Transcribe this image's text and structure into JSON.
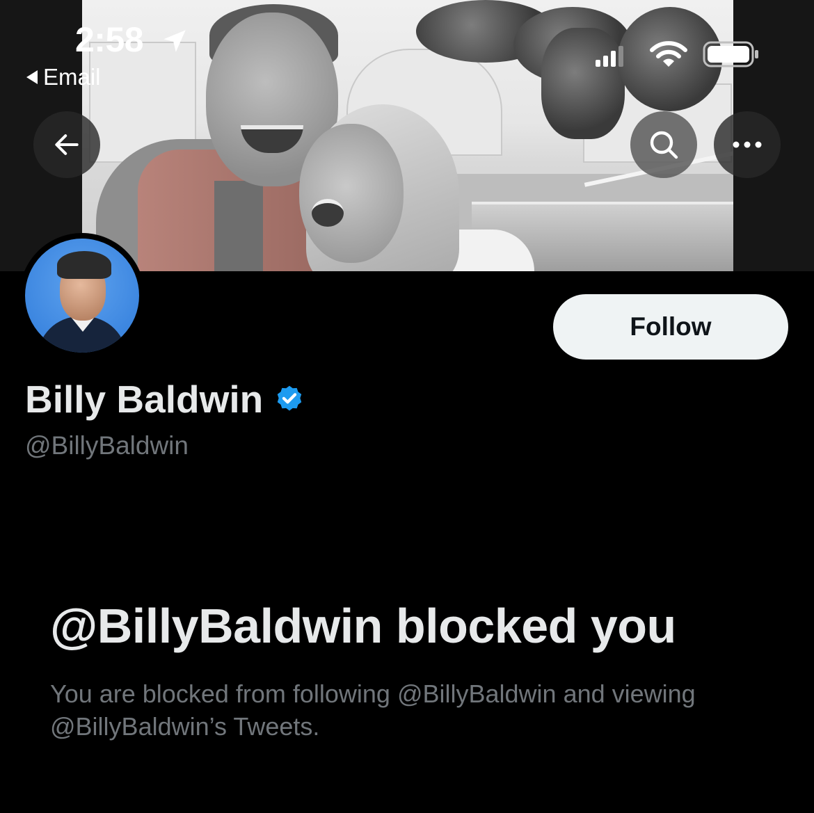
{
  "status_bar": {
    "time": "2:58",
    "back_app_label": "Email"
  },
  "profile": {
    "display_name": "Billy Baldwin",
    "verified": true,
    "handle": "@BillyBaldwin",
    "follow_label": "Follow"
  },
  "blocked_notice": {
    "title": "@BillyBaldwin blocked you",
    "description": "You are blocked from following @BillyBaldwin and viewing @BillyBaldwin’s Tweets."
  },
  "icons": {
    "back": "arrow-left-icon",
    "search": "search-icon",
    "more": "more-horizontal-icon",
    "verified": "verified-badge-icon",
    "location": "location-arrow-icon",
    "signal": "cellular-signal-icon",
    "wifi": "wifi-icon",
    "battery": "battery-icon"
  },
  "colors": {
    "background": "#000000",
    "primary_text": "#e7e9ea",
    "secondary_text": "#71767b",
    "verified_blue": "#1d9bf0",
    "follow_button_bg": "#eff3f4"
  }
}
